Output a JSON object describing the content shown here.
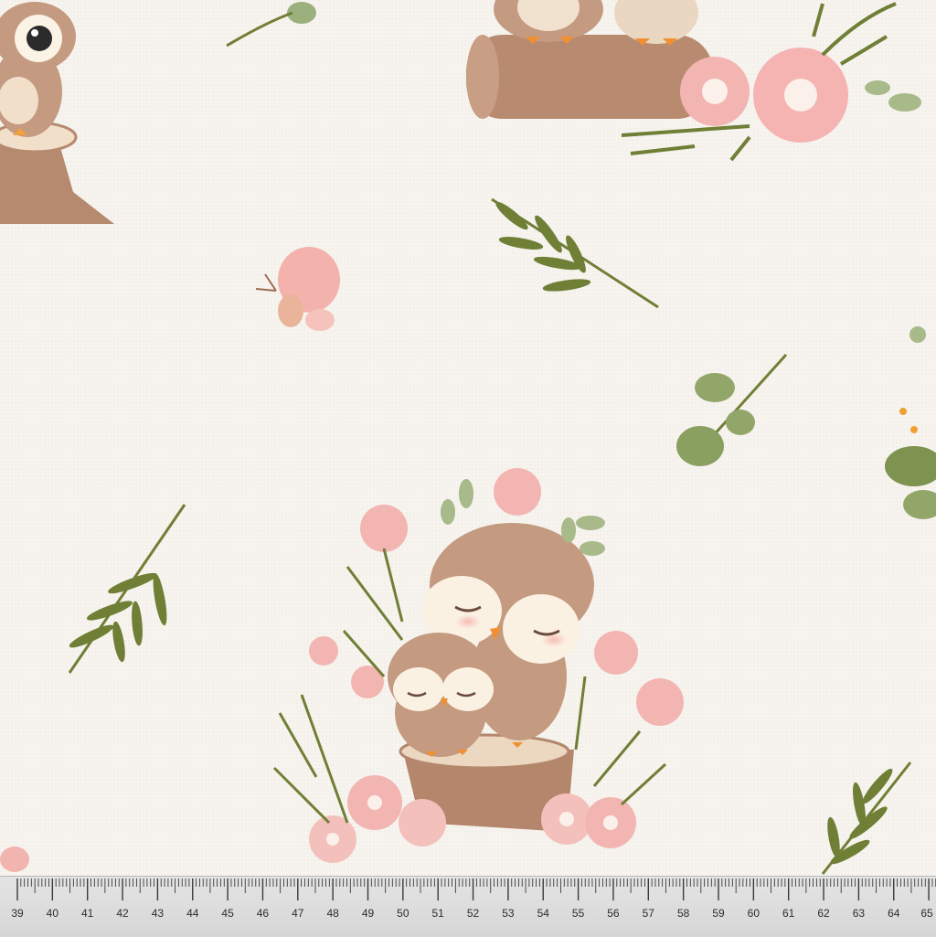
{
  "image": {
    "subject": "fabric",
    "colors": {
      "background": "#f7f4ef",
      "owl_brown": "#b98e74",
      "owl_face": "#fbf1e3",
      "pink_flower": "#f3b5b2",
      "leaf_green": "#6f7f35",
      "stump": "#b4876c",
      "ruler": "#d9d9d9"
    }
  },
  "ruler": {
    "labels": [
      "39",
      "40",
      "41",
      "42",
      "43",
      "44",
      "45",
      "46",
      "47",
      "48",
      "49",
      "50",
      "51",
      "52",
      "53",
      "54",
      "55",
      "56",
      "57",
      "58",
      "59",
      "60",
      "61",
      "62",
      "63",
      "64",
      "65"
    ]
  }
}
